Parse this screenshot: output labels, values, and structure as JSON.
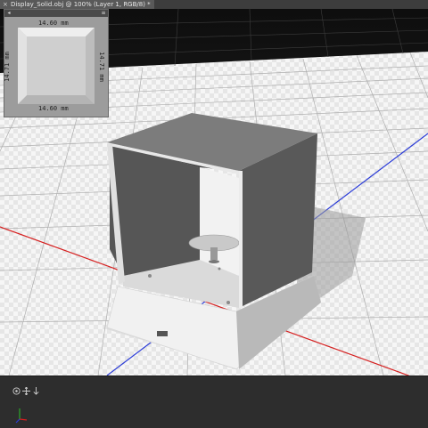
{
  "document": {
    "tab_title": "Display_Solid.obj @ 100% (Layer 1, RGB/8) *",
    "close_glyph": "×"
  },
  "navigator": {
    "dim_top": "14.60 mm",
    "dim_bottom": "14.60 mm",
    "dim_left": "14.71 mm",
    "dim_right": "14.71 mm",
    "menu_glyph": "≡"
  },
  "icons": {
    "orbit": "orbit-icon",
    "pan": "pan-icon",
    "dolly": "dolly-icon",
    "axis": "axis-widget-icon"
  },
  "colors": {
    "x_axis": "#d61f1f",
    "z_axis": "#2b3cd8",
    "y_axis": "#2aa82a",
    "grid": "#b0b0b0",
    "ground": "#f4f4f4"
  }
}
